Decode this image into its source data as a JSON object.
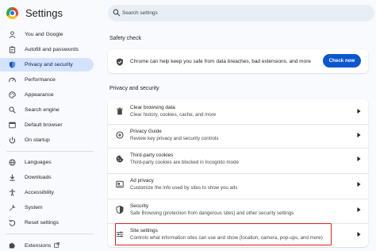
{
  "header": {
    "title": "Settings",
    "logo_icon": "chrome-logo-icon",
    "search": {
      "placeholder": "Search settings",
      "value": ""
    }
  },
  "sidebar": {
    "selected_index": 2,
    "items": [
      {
        "label": "You and Google",
        "icon": "person-icon"
      },
      {
        "label": "Autofill and passwords",
        "icon": "clipboard-icon"
      },
      {
        "label": "Privacy and security",
        "icon": "shield-icon"
      },
      {
        "label": "Performance",
        "icon": "speedometer-icon"
      },
      {
        "label": "Appearance",
        "icon": "palette-icon"
      },
      {
        "label": "Search engine",
        "icon": "search-icon"
      },
      {
        "label": "Default browser",
        "icon": "browser-icon"
      },
      {
        "label": "On startup",
        "icon": "power-icon"
      },
      {
        "label": "Languages",
        "icon": "globe-icon"
      },
      {
        "label": "Downloads",
        "icon": "download-icon"
      },
      {
        "label": "Accessibility",
        "icon": "accessibility-icon"
      },
      {
        "label": "System",
        "icon": "wrench-icon"
      },
      {
        "label": "Reset settings",
        "icon": "reset-icon"
      },
      {
        "label": "Extensions",
        "icon": "puzzle-icon"
      }
    ]
  },
  "safety_check": {
    "section_title": "Safety check",
    "text": "Chrome can help keep you safe from data breaches, bad extensions, and more",
    "button_label": "Check now"
  },
  "privacy": {
    "section_title": "Privacy and security",
    "rows": [
      {
        "title": "Clear browsing data",
        "desc": "Clear history, cookies, cache, and more",
        "icon": "trash-icon"
      },
      {
        "title": "Privacy Guide",
        "desc": "Review key privacy and security controls",
        "icon": "compass-icon"
      },
      {
        "title": "Third-party cookies",
        "desc": "Third-party cookies are blocked in Incognito mode",
        "icon": "cookie-icon"
      },
      {
        "title": "Ad privacy",
        "desc": "Customize the info used by sites to show you ads",
        "icon": "ad-privacy-icon"
      },
      {
        "title": "Security",
        "desc": "Safe Browsing (protection from dangerous sites) and other security settings",
        "icon": "shield-icon"
      },
      {
        "title": "Site settings",
        "desc": "Controls what information sites can use and show (location, camera, pop-ups, and more)",
        "icon": "sliders-icon"
      }
    ],
    "highlighted_row": 5
  },
  "colors": {
    "accent": "#0b57d0",
    "selected_nav_bg": "#d3e3fd",
    "highlight_border": "#e0221b"
  }
}
